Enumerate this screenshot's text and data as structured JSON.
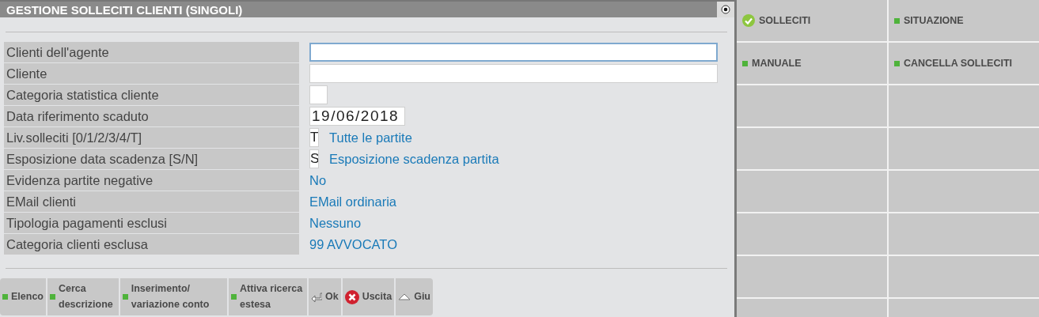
{
  "window": {
    "title": "GESTIONE SOLLECITI CLIENTI (SINGOLI)",
    "option_checked": true
  },
  "form": {
    "fields": [
      {
        "label": "Clienti dell'agente",
        "kind": "wide",
        "focused": true
      },
      {
        "label": "Cliente",
        "kind": "wide",
        "focused": false
      },
      {
        "label": "Categoria statistica cliente",
        "kind": "small",
        "focused": false
      },
      {
        "label": "Data riferimento scaduto",
        "kind": "date",
        "value": "19/06/2018",
        "focused": false
      },
      {
        "label": "Liv.solleciti [0/1/2/3/4/T]",
        "kind": "code",
        "value": "T",
        "description": "Tutte le partite",
        "focused": false
      },
      {
        "label": "Esposizione data scadenza [S/N]",
        "kind": "code",
        "value": "S",
        "description": "Esposizione scadenza partita",
        "focused": false
      },
      {
        "label": "Evidenza partite negative",
        "kind": "text",
        "description": "No"
      },
      {
        "label": "EMail clienti",
        "kind": "text",
        "description": "EMail ordinaria"
      },
      {
        "label": "Tipologia pagamenti esclusi",
        "kind": "text",
        "description": "Nessuno"
      },
      {
        "label": "Categoria clienti esclusa",
        "kind": "text",
        "description": "99 AVVOCATO"
      }
    ]
  },
  "toolbar": {
    "buttons": [
      {
        "label": "Elenco",
        "kind": "function"
      },
      {
        "label": "Cerca descrizione",
        "kind": "function"
      },
      {
        "label": "Inserimento/ variazione conto",
        "kind": "function"
      },
      {
        "label": "Attiva ricerca estesa",
        "kind": "function"
      },
      {
        "label": "Ok",
        "kind": "confirm"
      },
      {
        "label": "Uscita",
        "kind": "exit"
      },
      {
        "label": "Giu",
        "kind": "down"
      }
    ]
  },
  "side_menu": {
    "items": [
      {
        "label": "SOLLECITI",
        "selected": true
      },
      {
        "label": "SITUAZIONE",
        "selected": false
      },
      {
        "label": "MANUALE",
        "selected": false
      },
      {
        "label": "CANCELLA SOLLECITI",
        "selected": false
      }
    ]
  }
}
